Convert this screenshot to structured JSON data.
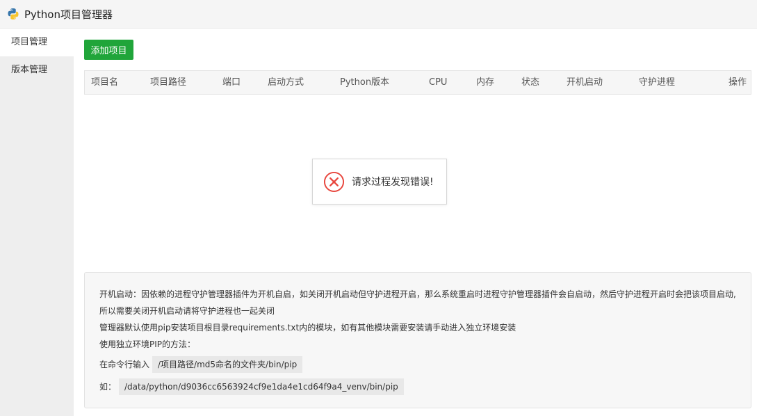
{
  "window": {
    "title": "Python项目管理器",
    "logo_icon": "python-logo-icon"
  },
  "sidebar": {
    "items": [
      {
        "label": "项目管理",
        "active": true
      },
      {
        "label": "版本管理",
        "active": false
      }
    ]
  },
  "toolbar": {
    "add_label": "添加项目",
    "accent_color": "#20a53a"
  },
  "table": {
    "columns": [
      "项目名",
      "项目路径",
      "端口",
      "启动方式",
      "Python版本",
      "CPU",
      "内存",
      "状态",
      "开机启动",
      "守护进程",
      "操作"
    ],
    "rows": []
  },
  "toast": {
    "icon": "error-circle-x-icon",
    "message": "请求过程发现错误!",
    "color": "#e8453c"
  },
  "tips": {
    "line1": "开机启动：因依赖的进程守护管理器插件为开机自启，如关闭开机启动但守护进程开启，那么系统重启时进程守护管理器插件会自启动，然后守护进程开启时会把该项目启动,",
    "line2": "所以需要关闭开机启动请将守护进程也一起关闭",
    "line3": "管理器默认使用pip安装项目根目录requirements.txt内的模块，如有其他模块需要安装请手动进入独立环境安装",
    "line4": "使用独立环境PIP的方法：",
    "line5_prefix": "在命令行输入",
    "line5_code": "/项目路径/md5命名的文件夹/bin/pip",
    "line6_prefix": "如：",
    "line6_code": "/data/python/d9036cc6563924cf9e1da4e1cd64f9a4_venv/bin/pip"
  }
}
